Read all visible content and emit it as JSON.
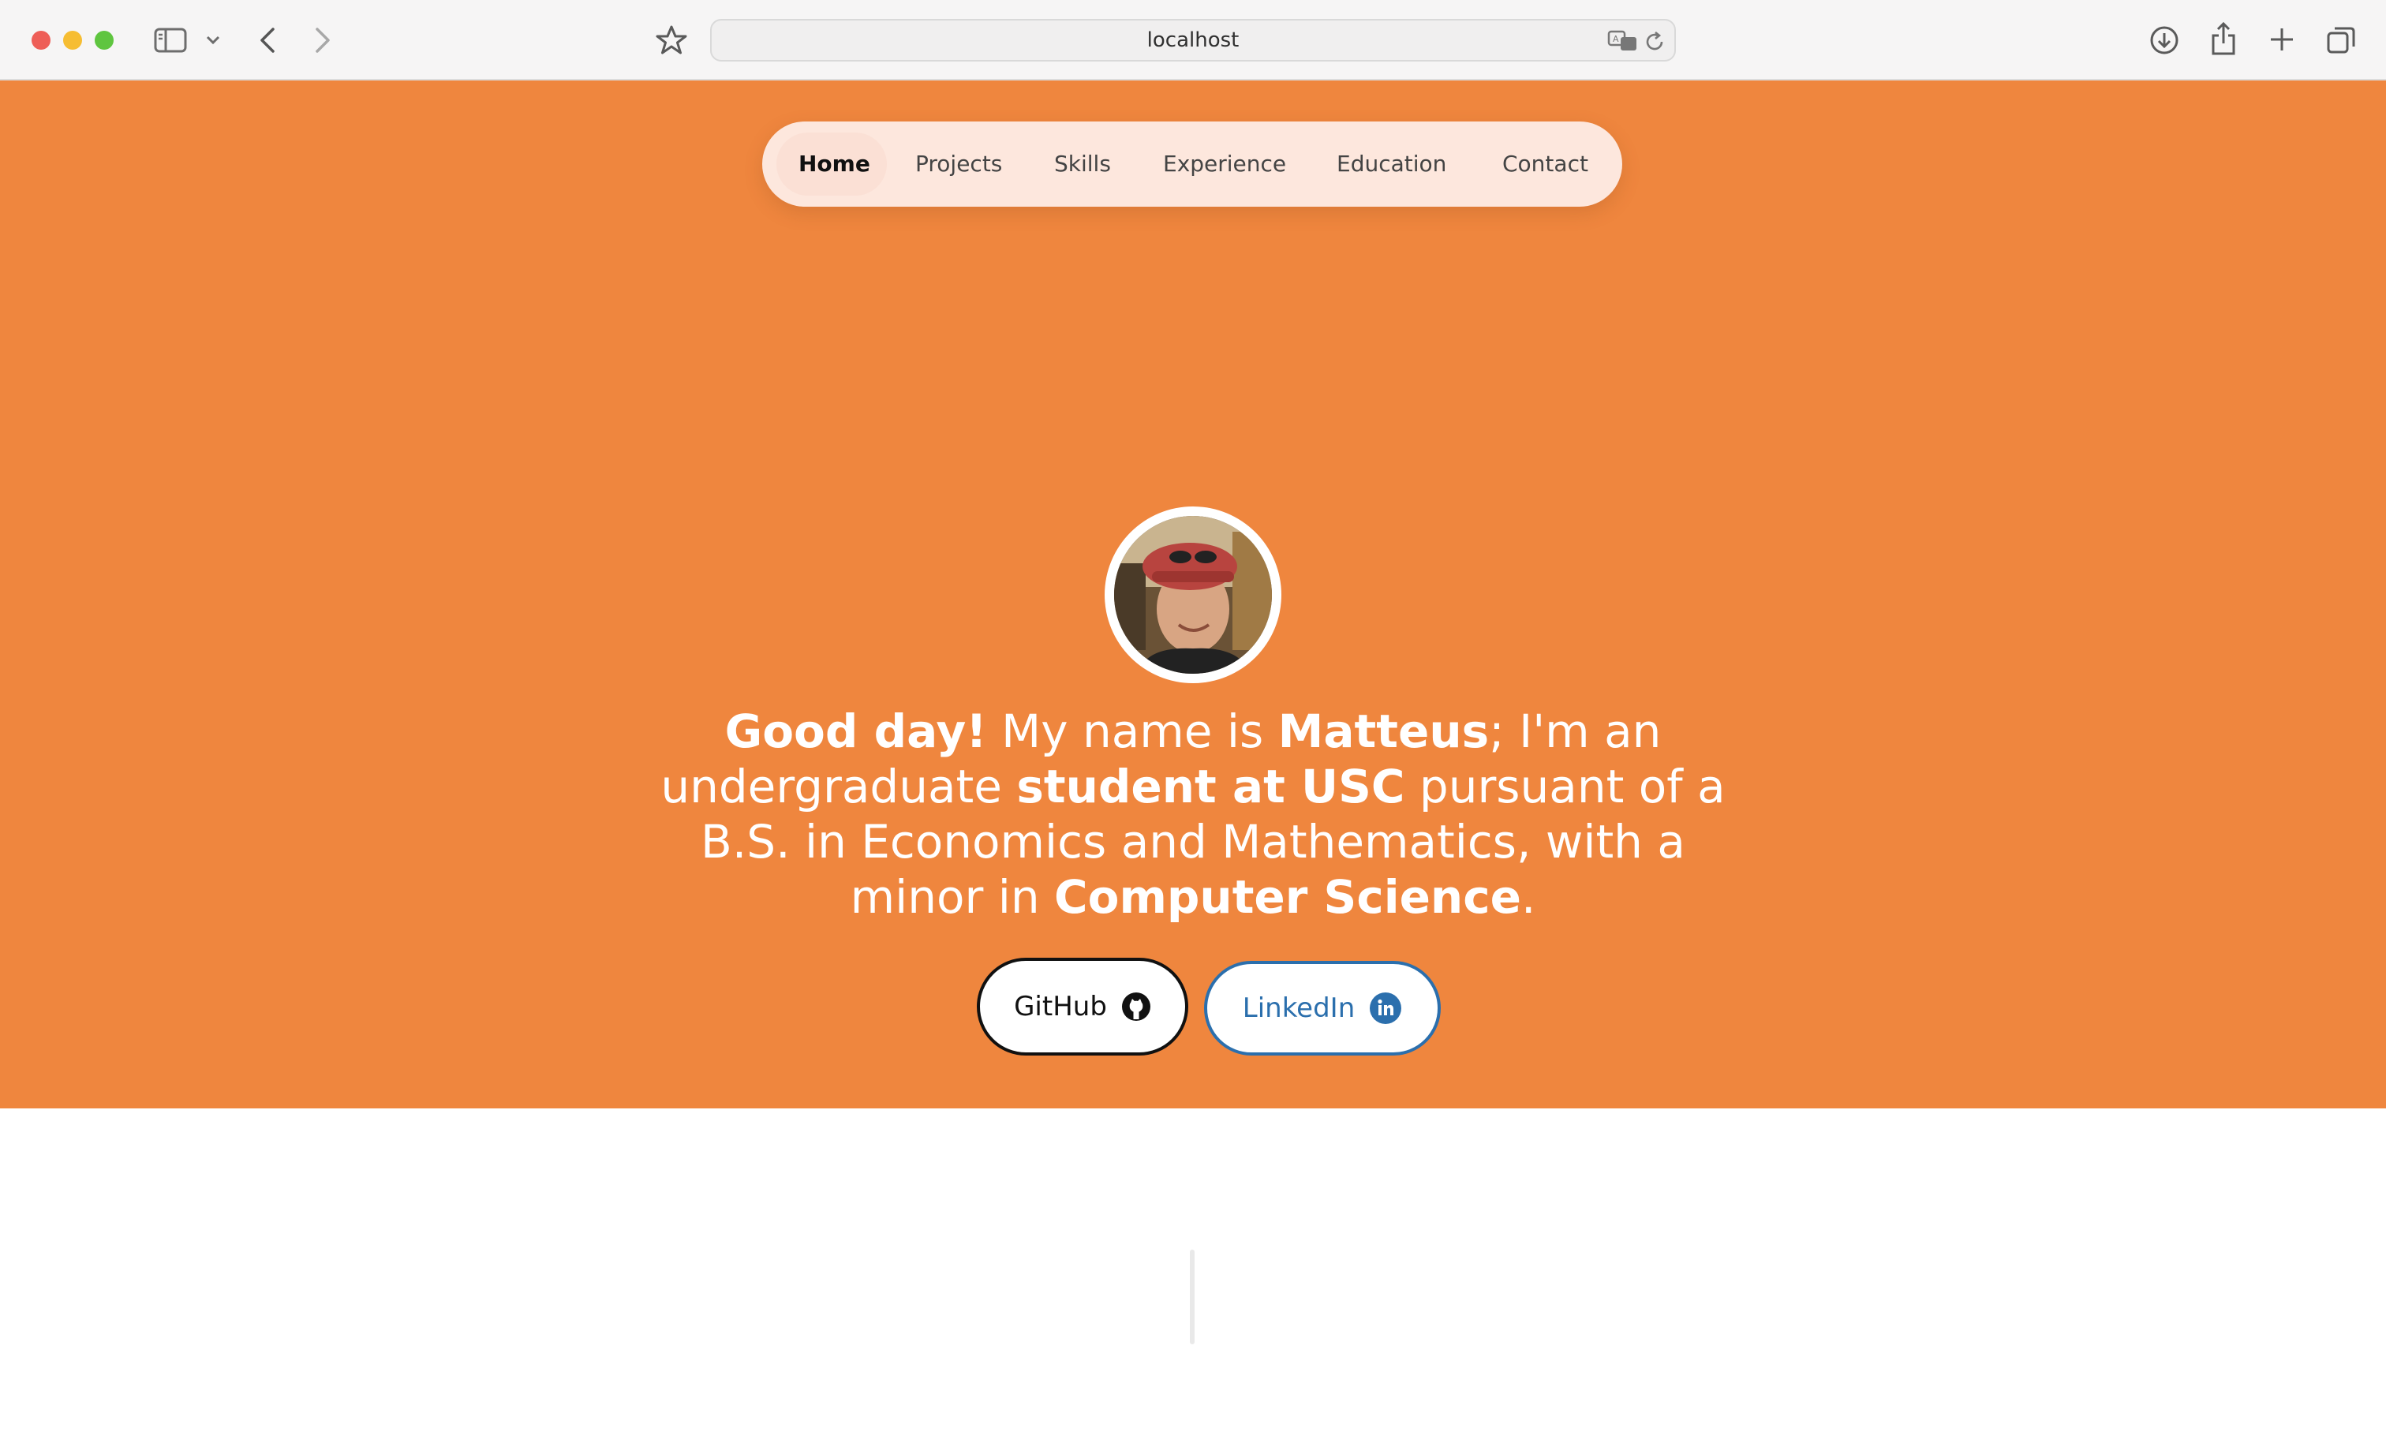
{
  "browser": {
    "url": "localhost",
    "icons": [
      "sidebar-icon",
      "chevron-down-icon",
      "back-icon",
      "forward-icon",
      "star-icon",
      "translate-icon",
      "reload-icon",
      "download-icon",
      "share-icon",
      "new-tab-icon",
      "tab-overview-icon"
    ]
  },
  "nav": {
    "items": [
      {
        "label": "Home",
        "active": true
      },
      {
        "label": "Projects"
      },
      {
        "label": "Skills"
      },
      {
        "label": "Experience"
      },
      {
        "label": "Education"
      },
      {
        "label": "Contact"
      }
    ]
  },
  "hero": {
    "intro": {
      "greeting": "Good day!",
      "t1": " My name is ",
      "name": "Matteus",
      "t2": "; I'm an undergraduate ",
      "role": "student at USC",
      "t3": " pursuant of a B.S. in Economics and Mathematics, with a minor in ",
      "minor": "Computer Science",
      "t4": "."
    },
    "buttons": {
      "github": "GitHub",
      "linkedin": "LinkedIn"
    }
  },
  "colors": {
    "accent": "#ef863e",
    "nav_bg": "#fde7dd",
    "linkedin": "#2b6fad"
  }
}
